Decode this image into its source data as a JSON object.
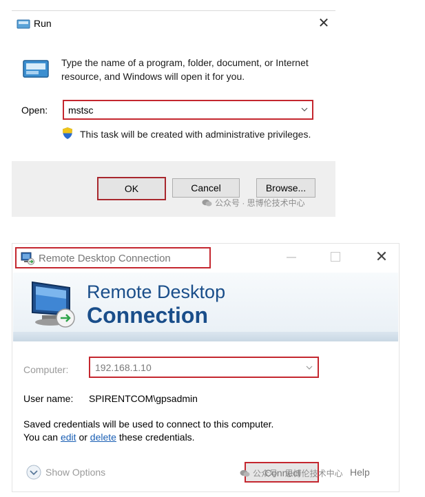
{
  "run_dialog": {
    "title": "Run",
    "close": "✕",
    "description": "Type the name of a program, folder, document, or Internet resource, and Windows will open it for you.",
    "open_label": "Open:",
    "open_value": "mstsc",
    "admin_note": "This task will be created with administrative privileges.",
    "ok_label": "OK",
    "cancel_label": "Cancel",
    "browse_label": "Browse...",
    "watermark": "公众号 · 思博伦技术中心"
  },
  "rdc_window": {
    "title": "Remote Desktop Connection",
    "close": "✕",
    "banner_line1": "Remote Desktop",
    "banner_line2": "Connection",
    "computer_label": "Computer:",
    "computer_value": "192.168.1.10",
    "username_label": "User name:",
    "username_value": "SPIRENTCOM\\gpsadmin",
    "credentials_line1": "Saved credentials will be used to connect to this computer.",
    "credentials_prefix": "You can ",
    "edit_link": "edit",
    "or_text": " or ",
    "delete_link": "delete",
    "credentials_suffix": " these credentials.",
    "show_options": "Show Options",
    "connect_label": "Connect",
    "help_label": "Help",
    "watermark": "公众号 · 思博伦技术中心"
  },
  "colors": {
    "highlight_box": "#c4262e",
    "rdc_banner_text": "#1a4e8a",
    "link": "#1a5fb4"
  },
  "icons": [
    "run-app-icon",
    "run-window-icon",
    "dropdown-chevron-icon",
    "uac-shield-icon",
    "rdc-app-icon",
    "rdc-monitor-icon",
    "minimize-icon",
    "maximize-icon",
    "close-icon",
    "show-options-chevron-icon",
    "wechat-icon"
  ]
}
